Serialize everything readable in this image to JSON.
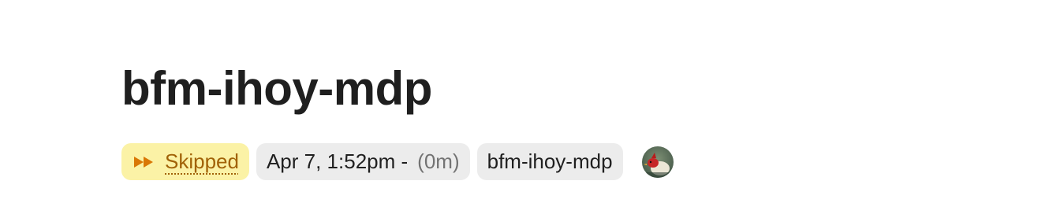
{
  "page": {
    "title": "bfm-ihoy-mdp"
  },
  "meta": {
    "status": {
      "icon": "fast-forward-icon",
      "label": "Skipped",
      "color": "#a16207",
      "background": "#fbf2a6"
    },
    "time": {
      "label": "Apr 7, 1:52pm -",
      "duration": "(0m)"
    },
    "name_chip": {
      "label": "bfm-ihoy-mdp"
    },
    "avatar": {
      "icon": "user-avatar"
    }
  }
}
